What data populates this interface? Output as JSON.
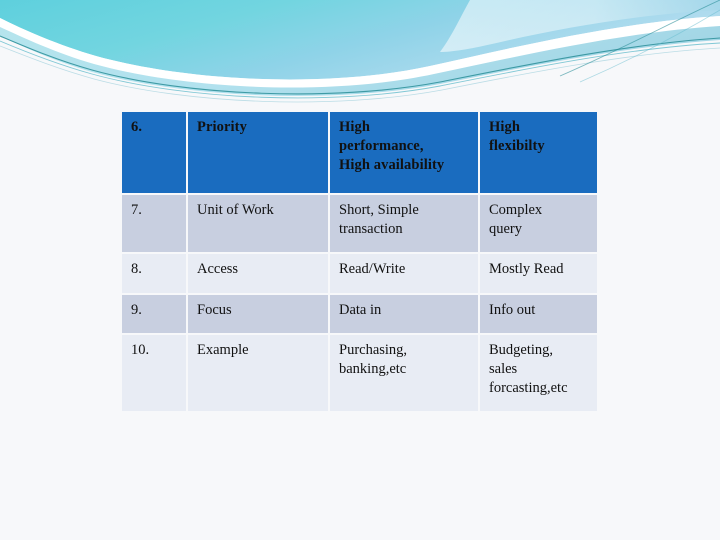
{
  "slide": {
    "background_color": "#f7f8fa",
    "decor": {
      "name": "flow-theme-swoosh",
      "colors": {
        "cyan": "#6ed3de",
        "light_blue": "#9fd8ea",
        "teal_line": "#1f8f96",
        "pale_blue": "#bfe4f0",
        "white": "#ffffff"
      }
    }
  },
  "table": {
    "accent_color": "#1a6cbf",
    "band_dark": "#c8cfe0",
    "band_light": "#e8ecf4",
    "columns": [
      {
        "key": "index",
        "width": 64
      },
      {
        "key": "attribute",
        "width": 140
      },
      {
        "key": "oltp",
        "width": 148
      },
      {
        "key": "olap",
        "width": 117
      }
    ],
    "rows": [
      {
        "style": "header",
        "index": "6.",
        "attribute": "Priority",
        "oltp_lines": [
          "High",
          "performance,",
          "High availability"
        ],
        "olap_lines": [
          "High",
          "flexibilty"
        ]
      },
      {
        "style": "band-dark",
        "index": "7.",
        "attribute": "Unit of Work",
        "oltp_lines": [
          "Short, Simple",
          "transaction"
        ],
        "olap_lines": [
          "Complex",
          "query"
        ]
      },
      {
        "style": "band-light",
        "index": "8.",
        "attribute": "Access",
        "oltp_lines": [
          "Read/Write"
        ],
        "olap_lines": [
          "Mostly Read"
        ]
      },
      {
        "style": "band-dark",
        "index": "9.",
        "attribute": "Focus",
        "oltp_lines": [
          "Data in"
        ],
        "olap_lines": [
          "Info out"
        ]
      },
      {
        "style": "band-light",
        "index": "10.",
        "attribute": "Example",
        "oltp_lines": [
          "Purchasing,",
          "banking,etc"
        ],
        "olap_lines": [
          "Budgeting,",
          "sales",
          "forcasting,etc"
        ]
      }
    ]
  }
}
